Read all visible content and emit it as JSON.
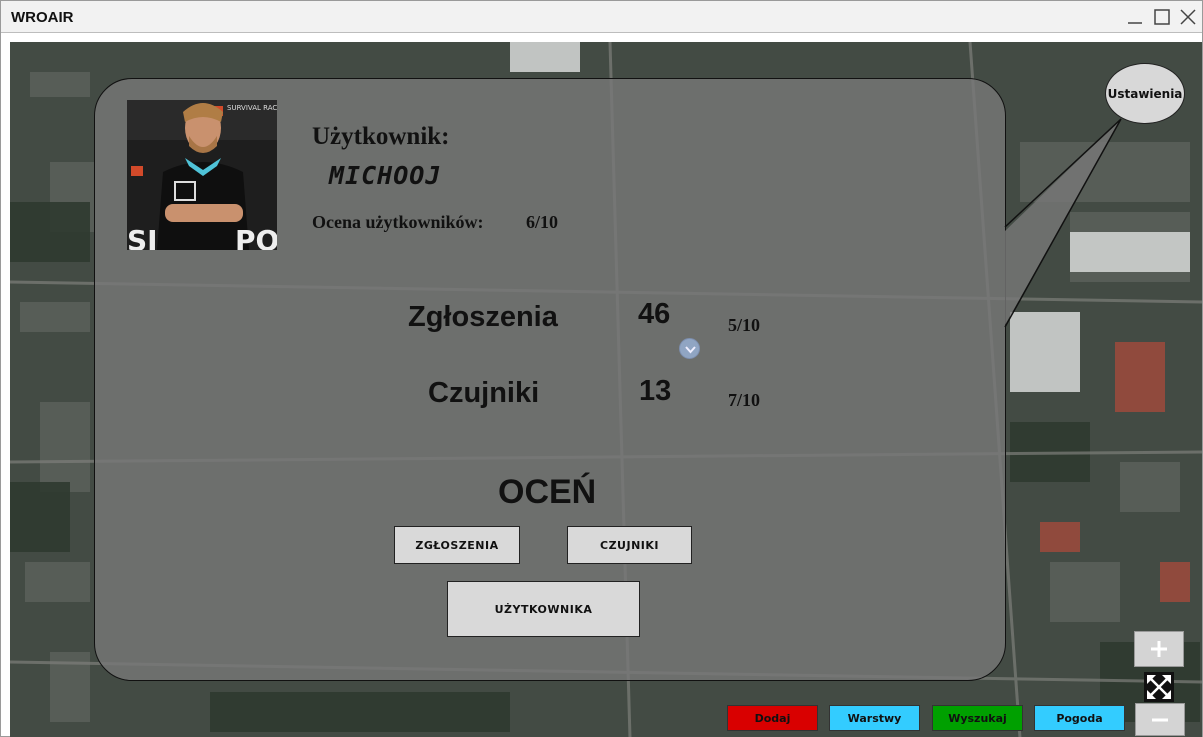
{
  "window": {
    "title": "WROAIR"
  },
  "profile": {
    "user_label": "Użytkownik:",
    "username": "MICHOOJ",
    "rating_label": "Ocena użytkowników:",
    "rating_value": "6/10",
    "avatar_text": {
      "top": "SURVIVAL RACE",
      "shirt": "SURVIVAL RACE",
      "bottom": "SI",
      "bottom_right": "POI"
    }
  },
  "stats": [
    {
      "name": "Zgłoszenia",
      "count": "46",
      "score": "5/10"
    },
    {
      "name": "Czujniki",
      "count": "13",
      "score": "7/10"
    }
  ],
  "rate": {
    "title": "OCEŃ",
    "buttons": [
      "ZGŁOSZENIA",
      "CZUJNIKI",
      "UŻYTKOWNIKA"
    ]
  },
  "settings_label": "Ustawienia",
  "toolbar": [
    {
      "label": "Dodaj",
      "color": "#d90000"
    },
    {
      "label": "Warstwy",
      "color": "#33ccff"
    },
    {
      "label": "Wyszukaj",
      "color": "#00a000"
    },
    {
      "label": "Pogoda",
      "color": "#33ccff"
    }
  ],
  "icons": [
    "minimize-icon",
    "maximize-icon",
    "close-icon",
    "zoom-in-icon",
    "fullscreen-icon",
    "zoom-out-icon",
    "map-center-marker"
  ]
}
